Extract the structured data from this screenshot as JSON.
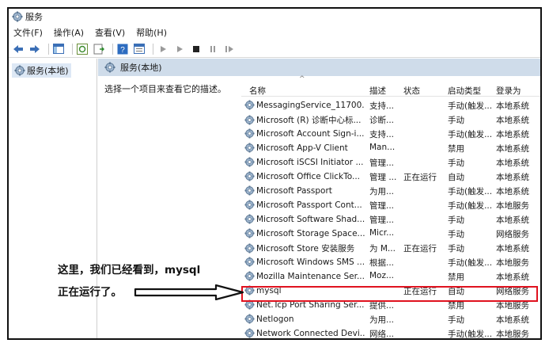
{
  "window": {
    "title": "服务"
  },
  "menu": [
    {
      "label": "文件(F)"
    },
    {
      "label": "操作(A)"
    },
    {
      "label": "查看(V)"
    },
    {
      "label": "帮助(H)"
    }
  ],
  "tree": {
    "root_label": "服务(本地)"
  },
  "panel": {
    "header": "服务(本地)",
    "description_hint": "选择一个项目来查看它的描述。"
  },
  "columns": {
    "name": "名称",
    "description": "描述",
    "status": "状态",
    "startup": "启动类型",
    "logon": "登录为"
  },
  "services": [
    {
      "name": "MessagingService_11700...",
      "description": "支持...",
      "status": "",
      "startup": "手动(触发...",
      "logon": "本地系统"
    },
    {
      "name": "Microsoft (R) 诊断中心标...",
      "description": "诊断...",
      "status": "",
      "startup": "手动",
      "logon": "本地系统"
    },
    {
      "name": "Microsoft Account Sign-i...",
      "description": "支持...",
      "status": "",
      "startup": "手动(触发...",
      "logon": "本地系统"
    },
    {
      "name": "Microsoft App-V Client",
      "description": "Man...",
      "status": "",
      "startup": "禁用",
      "logon": "本地系统"
    },
    {
      "name": "Microsoft iSCSI Initiator ...",
      "description": "管理...",
      "status": "",
      "startup": "手动",
      "logon": "本地系统"
    },
    {
      "name": "Microsoft Office ClickTo...",
      "description": "管理 ...",
      "status": "正在运行",
      "startup": "自动",
      "logon": "本地系统"
    },
    {
      "name": "Microsoft Passport",
      "description": "为用...",
      "status": "",
      "startup": "手动(触发...",
      "logon": "本地系统"
    },
    {
      "name": "Microsoft Passport Cont...",
      "description": "管理...",
      "status": "",
      "startup": "手动(触发...",
      "logon": "本地服务"
    },
    {
      "name": "Microsoft Software Shad...",
      "description": "管理...",
      "status": "",
      "startup": "手动",
      "logon": "本地系统"
    },
    {
      "name": "Microsoft Storage Space...",
      "description": "Micr...",
      "status": "",
      "startup": "手动",
      "logon": "网络服务"
    },
    {
      "name": "Microsoft Store 安装服务",
      "description": "为 M...",
      "status": "正在运行",
      "startup": "手动",
      "logon": "本地系统"
    },
    {
      "name": "Microsoft Windows SMS ...",
      "description": "根据...",
      "status": "",
      "startup": "手动(触发...",
      "logon": "本地服务"
    },
    {
      "name": "Mozilla Maintenance Ser...",
      "description": "Moz...",
      "status": "",
      "startup": "禁用",
      "logon": "本地系统"
    },
    {
      "name": "mysql",
      "description": "",
      "status": "正在运行",
      "startup": "自动",
      "logon": "网络服务"
    },
    {
      "name": "Net.Tcp Port Sharing Ser...",
      "description": "提供...",
      "status": "",
      "startup": "禁用",
      "logon": "本地服务"
    },
    {
      "name": "Netlogon",
      "description": "为用...",
      "status": "",
      "startup": "手动",
      "logon": "本地系统"
    },
    {
      "name": "Network Connected Devi...",
      "description": "网络...",
      "status": "",
      "startup": "手动(触发...",
      "logon": "本地服务"
    }
  ],
  "annotation": {
    "line1": "这里，我们已经看到，mysql",
    "line2": "正在运行了。",
    "color": "#e0121f"
  }
}
